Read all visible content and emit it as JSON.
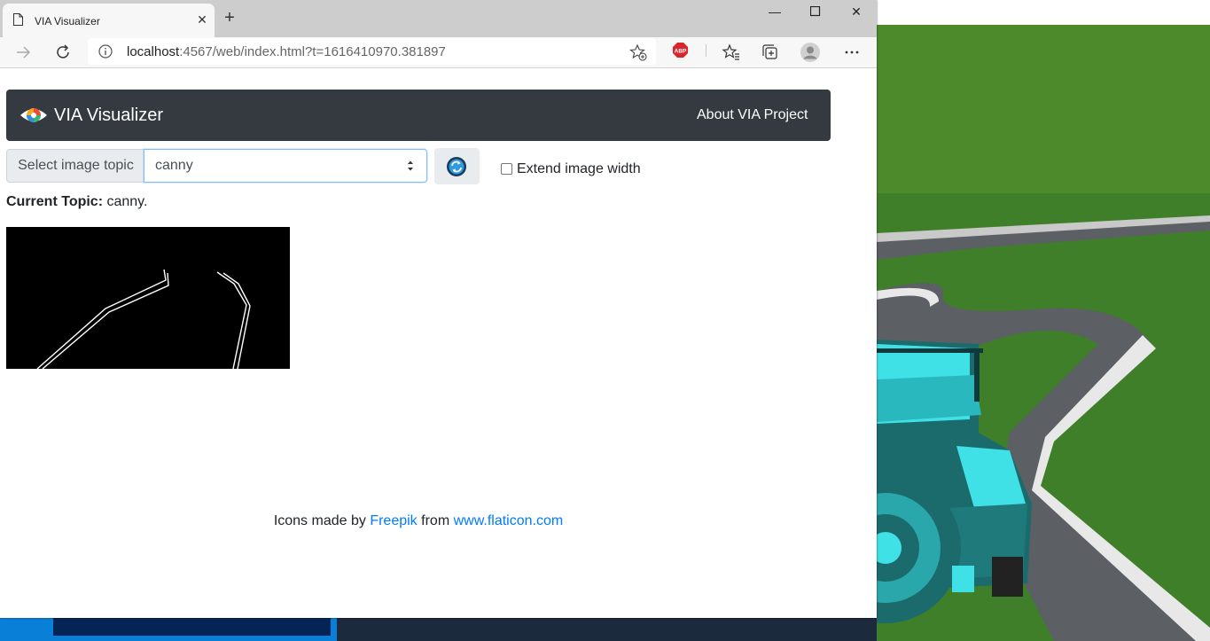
{
  "browser": {
    "tab_title": "VIA Visualizer",
    "url_host": "localhost",
    "url_rest": ":4567/web/index.html?t=1616410970.381897",
    "abp_label": "ABP"
  },
  "navbar": {
    "brand": "VIA Visualizer",
    "about": "About VIA Project"
  },
  "topic_select": {
    "prepend_label": "Select image topic",
    "selected": "canny"
  },
  "extend_checkbox": {
    "label": "Extend image width",
    "checked": false
  },
  "current_topic": {
    "label": "Current Topic:",
    "value": "canny."
  },
  "footer": {
    "prefix": "Icons made by",
    "link1": "Freepik",
    "middle": "from",
    "link2": "www.flaticon.com"
  },
  "colors": {
    "navbar_bg": "#343a40",
    "link": "#007bff",
    "car": "#3fe0e6",
    "grass": "#4c8a2c",
    "road": "#5c5f63"
  }
}
